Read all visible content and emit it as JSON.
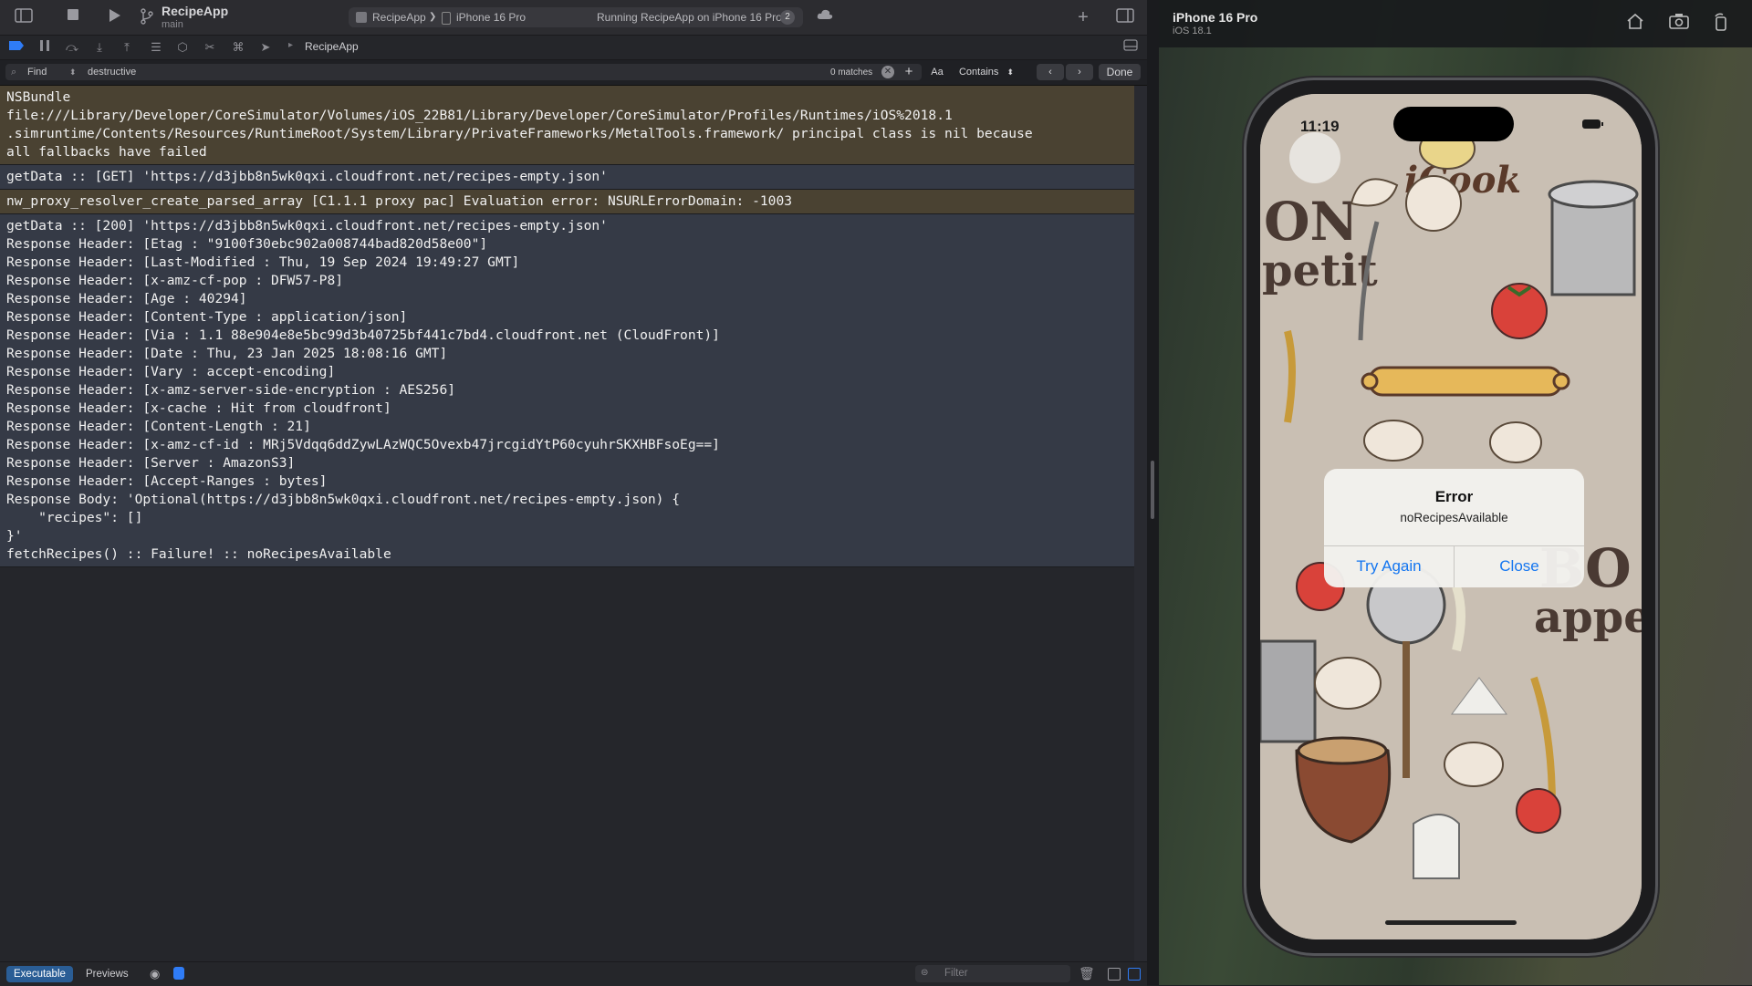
{
  "toolbar": {
    "scheme_title": "RecipeApp",
    "scheme_branch": "main",
    "target": "RecipeApp",
    "separator": "❯",
    "device": "iPhone 16 Pro",
    "status": "Running RecipeApp on iPhone 16 Pro",
    "status_badge": "2"
  },
  "debugbar": {
    "process": "RecipeApp"
  },
  "findbar": {
    "mode": "Find",
    "query": "destructive",
    "matches": "0 matches",
    "case_label": "Aa",
    "match_type": "Contains",
    "done_label": "Done"
  },
  "console": {
    "entries": [
      "NSBundle\nfile:///Library/Developer/CoreSimulator/Volumes/iOS_22B81/Library/Developer/CoreSimulator/Profiles/Runtimes/iOS%2018.1\n.simruntime/Contents/Resources/RuntimeRoot/System/Library/PrivateFrameworks/MetalTools.framework/ principal class is nil because\nall fallbacks have failed",
      "getData :: [GET] 'https://d3jbb8n5wk0qxi.cloudfront.net/recipes-empty.json'",
      "nw_proxy_resolver_create_parsed_array [C1.1.1 proxy pac] Evaluation error: NSURLErrorDomain: -1003",
      "getData :: [200] 'https://d3jbb8n5wk0qxi.cloudfront.net/recipes-empty.json'\nResponse Header: [Etag : \"9100f30ebc902a008744bad820d58e00\"]\nResponse Header: [Last-Modified : Thu, 19 Sep 2024 19:49:27 GMT]\nResponse Header: [x-amz-cf-pop : DFW57-P8]\nResponse Header: [Age : 40294]\nResponse Header: [Content-Type : application/json]\nResponse Header: [Via : 1.1 88e904e8e5bc99d3b40725bf441c7bd4.cloudfront.net (CloudFront)]\nResponse Header: [Date : Thu, 23 Jan 2025 18:08:16 GMT]\nResponse Header: [Vary : accept-encoding]\nResponse Header: [x-amz-server-side-encryption : AES256]\nResponse Header: [x-cache : Hit from cloudfront]\nResponse Header: [Content-Length : 21]\nResponse Header: [x-amz-cf-id : MRj5Vdqq6ddZywLAzWQC5Ovexb47jrcgidYtP60cyuhrSKXHBFsoEg==]\nResponse Header: [Server : AmazonS3]\nResponse Header: [Accept-Ranges : bytes]\nResponse Body: 'Optional(https://d3jbb8n5wk0qxi.cloudfront.net/recipes-empty.json) {\n    \"recipes\": []\n}'\nfetchRecipes() :: Failure! :: noRecipesAvailable"
    ]
  },
  "bottombar": {
    "tab_executable": "Executable",
    "tab_previews": "Previews",
    "filter_placeholder": "Filter"
  },
  "simulator": {
    "device_name": "iPhone 16 Pro",
    "os_version": "iOS 18.1",
    "status_time": "11:19",
    "app_title": "iCook",
    "bg_text_1": "ON\npetit",
    "bg_text_2": "BO\nappe",
    "alert": {
      "title": "Error",
      "message": "noRecipesAvailable",
      "try_again": "Try Again",
      "close": "Close"
    }
  },
  "colors": {
    "accent": "#1476f0",
    "warn_row": "#4a4232",
    "info_row": "#353a46"
  }
}
